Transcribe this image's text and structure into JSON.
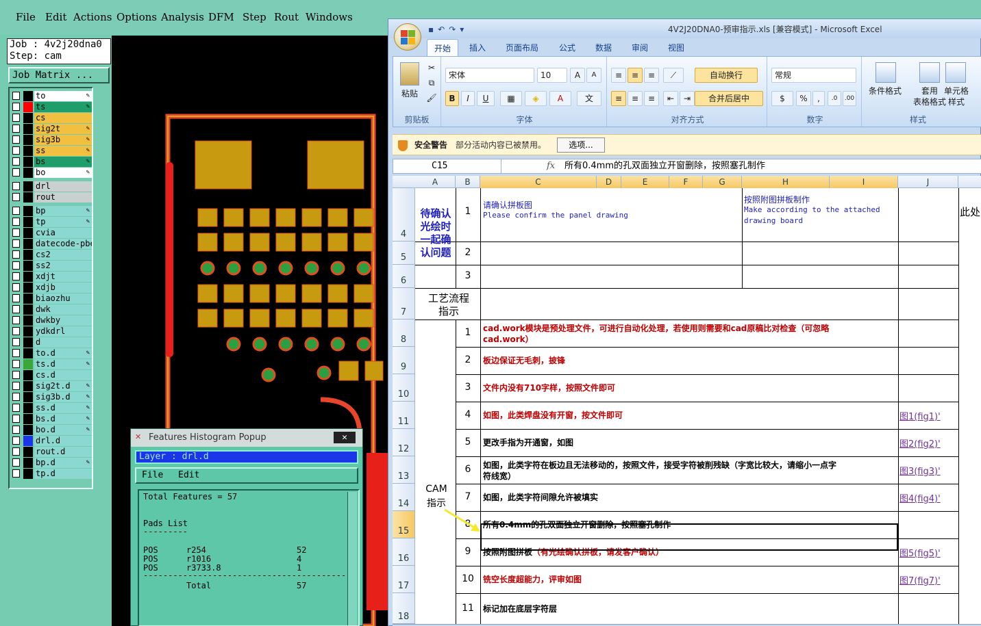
{
  "cam": {
    "menu": [
      "File",
      "Edit",
      "Actions",
      "Options",
      "Analysis",
      "DFM",
      "Step",
      "Rout",
      "Windows"
    ],
    "job_label": "Job : 4v2j20dna0",
    "step_label": "Step: cam",
    "job_matrix_button": "Job Matrix ...",
    "layers": [
      {
        "name": "to",
        "color": "#ffffff",
        "swatch": "#000000",
        "pen": true
      },
      {
        "name": "ts",
        "color": "#1f9d6b",
        "swatch": "#ff0000",
        "pen": true
      },
      {
        "name": "cs",
        "color": "#f2c040",
        "swatch": "#000000",
        "pen": false
      },
      {
        "name": "sig2t",
        "color": "#f2c040",
        "swatch": "#000000",
        "pen": true
      },
      {
        "name": "sig3b",
        "color": "#f2c040",
        "swatch": "#000000",
        "pen": true
      },
      {
        "name": "ss",
        "color": "#f2c040",
        "swatch": "#000000",
        "pen": true
      },
      {
        "name": "bs",
        "color": "#1f9d6b",
        "swatch": "#000000",
        "pen": true
      },
      {
        "name": "bo",
        "color": "#ffffff",
        "swatch": "#000000",
        "pen": true
      },
      {
        "name": "drl",
        "color": "#c9d0d0",
        "swatch": "#000000",
        "pen": false
      },
      {
        "name": "rout",
        "color": "#c9d0d0",
        "swatch": "#000000",
        "pen": false
      },
      {
        "name": "bp",
        "color": "#8ad8d0",
        "swatch": "#000000",
        "pen": true
      },
      {
        "name": "tp",
        "color": "#8ad8d0",
        "swatch": "#000000",
        "pen": true
      },
      {
        "name": "cvia",
        "color": "#8ad8d0",
        "swatch": "#000000",
        "pen": false
      },
      {
        "name": "datecode-pbe",
        "color": "#8ad8d0",
        "swatch": "#000000",
        "pen": false
      },
      {
        "name": "cs2",
        "color": "#8ad8d0",
        "swatch": "#000000",
        "pen": false
      },
      {
        "name": "ss2",
        "color": "#8ad8d0",
        "swatch": "#000000",
        "pen": false
      },
      {
        "name": "xdjt",
        "color": "#8ad8d0",
        "swatch": "#000000",
        "pen": false
      },
      {
        "name": "xdjb",
        "color": "#8ad8d0",
        "swatch": "#000000",
        "pen": false
      },
      {
        "name": "biaozhu",
        "color": "#8ad8d0",
        "swatch": "#000000",
        "pen": false
      },
      {
        "name": "dwk",
        "color": "#8ad8d0",
        "swatch": "#000000",
        "pen": false
      },
      {
        "name": "dwkby",
        "color": "#8ad8d0",
        "swatch": "#000000",
        "pen": false
      },
      {
        "name": "ydkdrl",
        "color": "#8ad8d0",
        "swatch": "#000000",
        "pen": false
      },
      {
        "name": "d",
        "color": "#8ad8d0",
        "swatch": "#000000",
        "pen": false
      },
      {
        "name": "to.d",
        "color": "#8ad8d0",
        "swatch": "#000000",
        "pen": true
      },
      {
        "name": "ts.d",
        "color": "#8ad8d0",
        "swatch": "#3aa838",
        "pen": true
      },
      {
        "name": "cs.d",
        "color": "#8ad8d0",
        "swatch": "#000000",
        "pen": false
      },
      {
        "name": "sig2t.d",
        "color": "#8ad8d0",
        "swatch": "#000000",
        "pen": true
      },
      {
        "name": "sig3b.d",
        "color": "#8ad8d0",
        "swatch": "#000000",
        "pen": true
      },
      {
        "name": "ss.d",
        "color": "#8ad8d0",
        "swatch": "#000000",
        "pen": true
      },
      {
        "name": "bs.d",
        "color": "#8ad8d0",
        "swatch": "#000000",
        "pen": true
      },
      {
        "name": "bo.d",
        "color": "#8ad8d0",
        "swatch": "#000000",
        "pen": true
      },
      {
        "name": "drl.d",
        "color": "#8ad8d0",
        "swatch": "#1b35e8",
        "pen": false
      },
      {
        "name": "rout.d",
        "color": "#8ad8d0",
        "swatch": "#000000",
        "pen": false
      },
      {
        "name": "bp.d",
        "color": "#8ad8d0",
        "swatch": "#000000",
        "pen": true
      },
      {
        "name": "tp.d",
        "color": "#8ad8d0",
        "swatch": "#000000",
        "pen": false
      }
    ]
  },
  "histogram": {
    "title": "Features Histogram Popup",
    "close_label": "✕",
    "layer_label": "Layer : drl.d",
    "menu": [
      "File",
      "Edit"
    ],
    "total_line": "Total Features = 57",
    "pads_header": "Pads List",
    "divider_short": "---------",
    "rows": [
      {
        "type": "POS",
        "symbol": "r254",
        "count": "52"
      },
      {
        "type": "POS",
        "symbol": "r1016",
        "count": "4"
      },
      {
        "type": "POS",
        "symbol": "r3733.8",
        "count": "1"
      }
    ],
    "divider_long": "-------------------------------------------",
    "total_label": "Total",
    "total_count": "57"
  },
  "excel": {
    "title": "4V2J20DNA0-预审指示.xls [兼容模式] - Microsoft Excel",
    "tabs": [
      "开始",
      "插入",
      "页面布局",
      "公式",
      "数据",
      "审阅",
      "视图"
    ],
    "active_tab": "开始",
    "ribbon": {
      "paste": "粘贴",
      "clipboard": "剪贴板",
      "font_name": "宋体",
      "font_size": "10",
      "font_group": "字体",
      "wrap_text": "自动换行",
      "merge_center": "合并后居中",
      "align_group": "对齐方式",
      "number_format": "常规",
      "number_group": "数字",
      "cond_format": "条件格式",
      "table_format_1": "套用",
      "table_format_2": "表格格式",
      "cell_style_1": "单元格",
      "cell_style_2": "样式",
      "styles_group": "样式",
      "bold": "B",
      "italic": "I",
      "underline": "U",
      "percent": "%",
      "comma": ","
    },
    "security": {
      "label": "安全警告",
      "message": "部分活动内容已被禁用。",
      "options_button": "选项..."
    },
    "name_box": "C15",
    "fx": "fx",
    "formula": "所有0.4mm的孔双面独立开窗删除，按照塞孔制作",
    "columns": [
      "A",
      "B",
      "C",
      "D",
      "E",
      "F",
      "G",
      "H",
      "I",
      "J",
      ""
    ],
    "rows": [
      {
        "num": "4",
        "b": "1",
        "c_cn": "请确认拼板图",
        "c_en": "Please confirm the panel drawing",
        "h_cn": "按照附图拼板制作",
        "h_en1": "Make according to the attached",
        "h_en2": "drawing board",
        "j_extra": "此处"
      },
      {
        "num": "5",
        "b": "2"
      },
      {
        "num": "6",
        "b": "3"
      },
      {
        "num": "7",
        "a": [
          "工艺流程",
          "指示"
        ]
      },
      {
        "num": "8",
        "b": "1",
        "text1": "cad.work模块是预处理文件，可进行自动化处理，若使用则需要和cad原稿比对检查（可忽略",
        "text2": "cad.work）",
        "red": true
      },
      {
        "num": "9",
        "b": "2",
        "text1": "板边保证无毛刺，披锋",
        "red": true
      },
      {
        "num": "10",
        "b": "3",
        "text1": "文件内没有710字样，按照文件即可",
        "red": true
      },
      {
        "num": "11",
        "b": "4",
        "text1": "如图，此类焊盘没有开窗，按文件即可",
        "red": true,
        "link": "图1(fig1)'"
      },
      {
        "num": "12",
        "b": "5",
        "text1": "更改手指为开通窗，如图",
        "link": "图2(fig2)'"
      },
      {
        "num": "13",
        "b": "6",
        "text1": "如图，此类字符在板边且无法移动的，按照文件，接受字符被削残缺（字宽比较大，请缩小一点字",
        "text2": "符线宽）",
        "link": "图3(fig3)'"
      },
      {
        "num": "14",
        "b": "7",
        "text1": "如图，此类字符间隙允许被填实",
        "link": "图4(fig4)'"
      },
      {
        "num": "15",
        "b": "8",
        "text1": "所有0.4mm的孔双面独立开窗删除，按照塞孔制作"
      },
      {
        "num": "16",
        "b": "9",
        "text1": "按照附图拼板",
        "text_red": "（有光绘确认拼板，请发客户确认）",
        "link": "图5(fig5)'"
      },
      {
        "num": "17",
        "b": "10",
        "text1": "铣空长度超能力，评审如图",
        "red": true,
        "link": "图7(fig7)'"
      },
      {
        "num": "18",
        "b": "11",
        "text1": "标记加在底层字符层"
      }
    ],
    "a_group_4": [
      "待确认",
      "光绘时",
      "一起确",
      "认问题"
    ],
    "a_group_cam": [
      "CAM",
      "指示"
    ]
  }
}
